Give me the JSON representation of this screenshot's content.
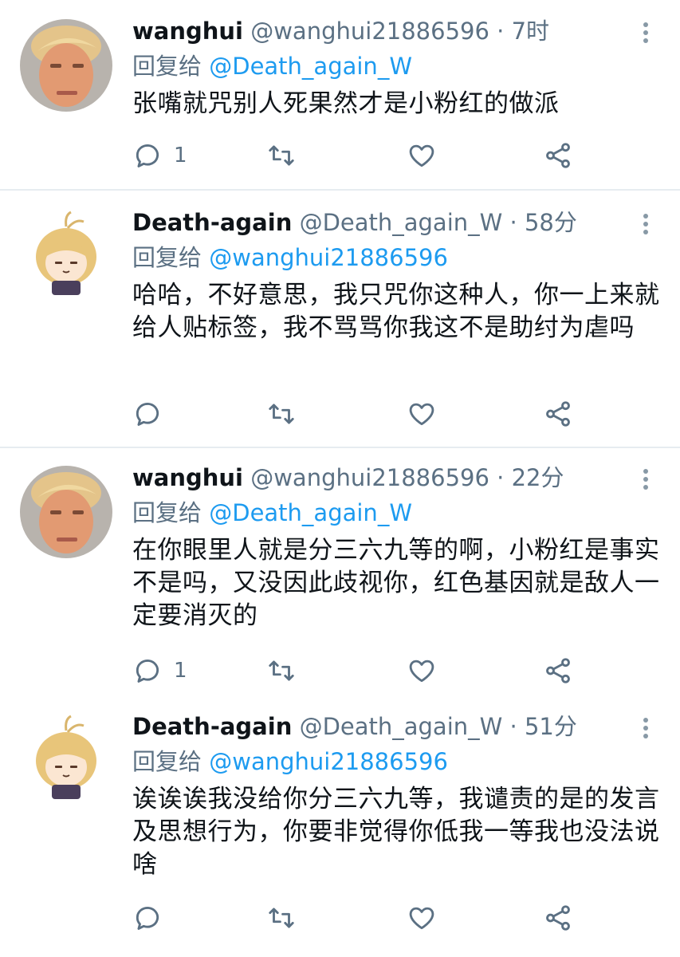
{
  "reply_prefix": "回复给",
  "tweets": [
    {
      "name": "wanghui",
      "handle": "@wanghui21886596",
      "time": "7时",
      "reply_to": "@Death_again_W",
      "text": "张嘴就咒别人死果然才是小粉红的做派",
      "reply_count": "1",
      "avatar": "trump-face"
    },
    {
      "name": "Death-again",
      "handle": "@Death_again_W",
      "time": "58分",
      "reply_to": "@wanghui21886596",
      "text": "哈哈，不好意思，我只咒你这种人，你一上来就给人贴标签，我不骂骂你我这不是助纣为虐吗",
      "reply_count": "",
      "avatar": "anime-girl"
    },
    {
      "name": "wanghui",
      "handle": "@wanghui21886596",
      "time": "22分",
      "reply_to": "@Death_again_W",
      "text": "在你眼里人就是分三六九等的啊，小粉红是事实不是吗，又没因此歧视你，红色基因就是敌人一定要消灭的",
      "reply_count": "1",
      "avatar": "trump-face"
    },
    {
      "name": "Death-again",
      "handle": "@Death_again_W",
      "time": "51分",
      "reply_to": "@wanghui21886596",
      "text": "诶诶诶我没给你分三六九等，我谴责的是的发言及思想行为，你要非觉得你低我一等我也没法说啥",
      "reply_count": "",
      "avatar": "anime-girl"
    }
  ],
  "colors": {
    "text": "#0f1419",
    "secondary": "#5b7083",
    "link": "#1d9bf0",
    "divider": "#e6ecf0"
  }
}
